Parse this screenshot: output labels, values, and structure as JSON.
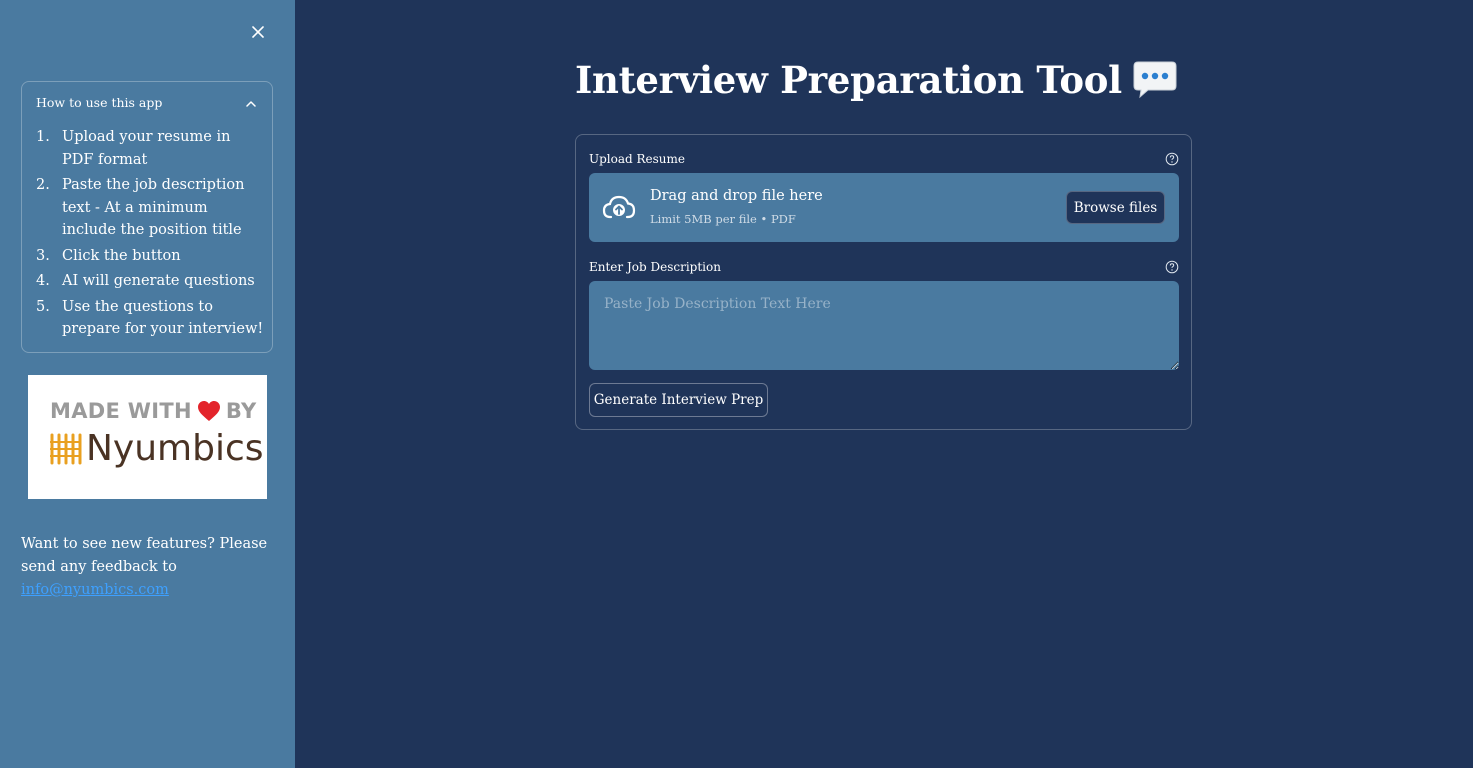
{
  "colors": {
    "background": "#1f3459",
    "sidebar": "#4a7aa0",
    "link": "#3ea0ff",
    "brand_mark": "#e9a020",
    "brand_text": "#4a3324",
    "heart": "#e3242b"
  },
  "sidebar": {
    "close_icon": "close-icon",
    "expander": {
      "title": "How to use this app",
      "icon": "chevron-up-icon",
      "steps": [
        {
          "num": "1.",
          "text": "Upload your resume in PDF format"
        },
        {
          "num": "2.",
          "text": "Paste the job description text - At a minimum include the position title"
        },
        {
          "num": "3.",
          "text": "Click the button"
        },
        {
          "num": "4.",
          "text": "AI will generate questions"
        },
        {
          "num": "5.",
          "text": "Use the questions to prepare for your interview!"
        }
      ]
    },
    "logo": {
      "made_with": "MADE WITH",
      "by": "BY",
      "brand": "Nyumbics"
    },
    "feedback": {
      "text": "Want to see new features? Please send any feedback to ",
      "email": "info@nyumbics.com"
    }
  },
  "main": {
    "title": "Interview Preparation Tool",
    "title_icon": "speech-bubble-icon",
    "upload": {
      "label": "Upload Resume",
      "drop_text": "Drag and drop file here",
      "limit_text": "Limit 5MB per file • PDF",
      "browse_label": "Browse files"
    },
    "job_description": {
      "label": "Enter Job Description",
      "placeholder": "Paste Job Description Text Here",
      "value": ""
    },
    "generate_label": "Generate Interview Prep"
  }
}
